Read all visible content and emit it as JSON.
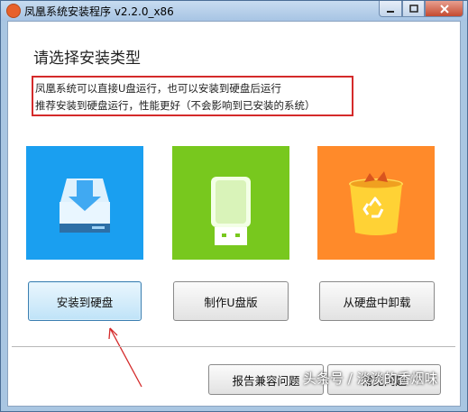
{
  "window": {
    "title": "凤凰系统安装程序 v2.2.0_x86"
  },
  "main": {
    "heading": "请选择安装类型",
    "description": [
      "凤凰系统可以直接U盘运行，也可以安装到硬盘后运行",
      "推荐安装到硬盘运行，性能更好（不会影响到已安装的系统）"
    ]
  },
  "options": [
    {
      "label": "安装到硬盘",
      "icon": "hard-disk-download-icon",
      "color": "#1a9ff0"
    },
    {
      "label": "制作U盘版",
      "icon": "usb-drive-icon",
      "color": "#78c81e"
    },
    {
      "label": "从硬盘中卸载",
      "icon": "recycle-bin-icon",
      "color": "#ff8a2a"
    }
  ],
  "footer": {
    "report_label": "报告兼容问题",
    "faq_label": "常见问题"
  },
  "watermark": "头条号 / 淡淡的香烟味",
  "colors": {
    "highlight_border": "#d42a2a"
  }
}
